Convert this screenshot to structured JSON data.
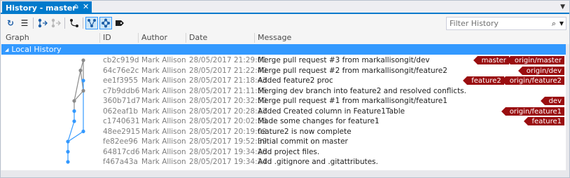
{
  "window": {
    "tab_title": "History - master",
    "pin_glyph": "⌂",
    "close_glyph": "✕",
    "menu_glyph": "▼"
  },
  "toolbar": {
    "refresh_glyph": "↻",
    "list_glyph": "☰",
    "filter_placeholder": "Filter History",
    "filter_icon_glyph": "⌕",
    "filter_drop_glyph": "▼"
  },
  "columns": {
    "graph": "Graph",
    "id": "ID",
    "author": "Author",
    "date": "Date",
    "message": "Message"
  },
  "group": {
    "label": "Local History",
    "toggle_glyph": "◢"
  },
  "colors": {
    "accent": "#007acc",
    "selection": "#3399ff",
    "ref_badge": "#9a0e10",
    "graph_blue": "#3399ff",
    "graph_gray": "#8a8a8a"
  },
  "commits": [
    {
      "id": "cb2c919d",
      "author": "Mark Allison",
      "date": "28/05/2017 21:29:01",
      "message": "Merge pull request #3 from markallisongit/dev",
      "refs": [
        "master",
        "origin/master"
      ]
    },
    {
      "id": "64c76e2c",
      "author": "Mark Allison",
      "date": "28/05/2017 21:22:40",
      "message": "Merge pull request #2 from markallisongit/feature2",
      "refs": [
        "origin/dev"
      ]
    },
    {
      "id": "ee1f3955",
      "author": "Mark Allison",
      "date": "28/05/2017 21:18:43",
      "message": "Added feature2 proc",
      "refs": [
        "feature2",
        "origin/feature2"
      ]
    },
    {
      "id": "c7b9ddb6",
      "author": "Mark Allison",
      "date": "28/05/2017 21:11:55",
      "message": "Merging dev branch into feature2 and resolved conflicts.",
      "refs": []
    },
    {
      "id": "360b71d7",
      "author": "Mark Allison",
      "date": "28/05/2017 20:32:50",
      "message": "Merge pull request #1 from markallisongit/feature1",
      "refs": [
        "dev"
      ]
    },
    {
      "id": "062eaf1b",
      "author": "Mark Allison",
      "date": "28/05/2017 20:28:17",
      "message": "Added Created column in Feature1Table",
      "refs": [
        "origin/feature1"
      ]
    },
    {
      "id": "c1740631",
      "author": "Mark Allison",
      "date": "28/05/2017 20:02:58",
      "message": "Made some changes for feature1",
      "refs": [
        "feature1"
      ]
    },
    {
      "id": "48ee2915",
      "author": "Mark Allison",
      "date": "28/05/2017 20:19:02",
      "message": "feature2 is now complete",
      "refs": []
    },
    {
      "id": "fe82ee96",
      "author": "Mark Allison",
      "date": "28/05/2017 19:52:39",
      "message": "Initial commit on master",
      "refs": []
    },
    {
      "id": "64817cd6",
      "author": "Mark Allison",
      "date": "28/05/2017 19:34:26",
      "message": "Add project files.",
      "refs": []
    },
    {
      "id": "f467a43a",
      "author": "Mark Allison",
      "date": "28/05/2017 19:34:24",
      "message": "Add .gitignore and .gitattributes.",
      "refs": []
    }
  ],
  "graph_nodes": [
    {
      "lane": 3,
      "color": "gray"
    },
    {
      "lane": 2,
      "color": "gray"
    },
    {
      "lane": 3,
      "color": "blue"
    },
    {
      "lane": 3,
      "color": "gray"
    },
    {
      "lane": 1,
      "color": "gray"
    },
    {
      "lane": 1,
      "color": "blue"
    },
    {
      "lane": 1,
      "color": "blue"
    },
    {
      "lane": 3,
      "color": "blue"
    },
    {
      "lane": 0,
      "color": "blue"
    },
    {
      "lane": 0,
      "color": "blue"
    },
    {
      "lane": 0,
      "color": "blue"
    }
  ]
}
